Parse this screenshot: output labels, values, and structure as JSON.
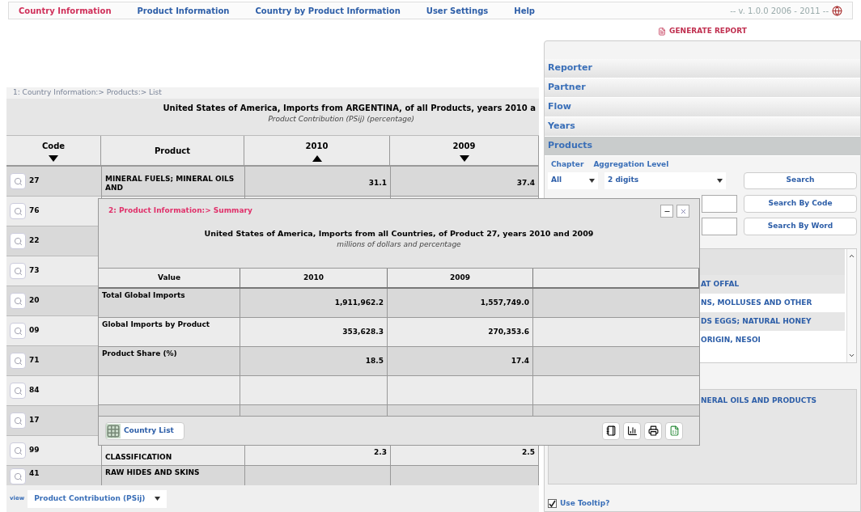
{
  "nav": {
    "tabs": [
      {
        "label": "Country Information",
        "selected": true
      },
      {
        "label": "Product Information",
        "selected": false
      },
      {
        "label": "Country by Product Information",
        "selected": false
      },
      {
        "label": "User Settings",
        "selected": false
      },
      {
        "label": "Help",
        "selected": false
      }
    ],
    "version": "-- v. 1.0.0 2006 - 2011 --"
  },
  "list_panel": {
    "breadcrumb": "1: Country Information:> Products:> List",
    "title": "United States of America, Imports from ARGENTINA, of all Products, years 2010 a",
    "subtitle": "Product Contribution (PSij) (percentage)",
    "columns": [
      {
        "label": "Code",
        "arrow": true,
        "ascending": false
      },
      {
        "label": "Product",
        "arrow": false
      },
      {
        "label": "2010",
        "arrow": true,
        "ascending": true
      },
      {
        "label": "2009",
        "arrow": true,
        "ascending": false
      }
    ],
    "rows": [
      {
        "code": "27",
        "product": "MINERAL FUELS; MINERAL OILS AND",
        "v2010": "31.1",
        "v2009": "37.4"
      },
      {
        "code": "76"
      },
      {
        "code": "22"
      },
      {
        "code": "73"
      },
      {
        "code": "20"
      },
      {
        "code": "09"
      },
      {
        "code": "71"
      },
      {
        "code": "84"
      },
      {
        "code": "17"
      },
      {
        "code": "99",
        "product": "CLASSIFICATION",
        "v2010": "2.3",
        "v2009": "2.5"
      },
      {
        "code": "41",
        "product": "RAW HIDES AND SKINS"
      }
    ],
    "view_label": "view",
    "view_value": "Product Contribution (PSij)"
  },
  "report_panel": {
    "header": "GENERATE REPORT",
    "sections": [
      {
        "label": "Reporter",
        "expanded": false
      },
      {
        "label": "Partner",
        "expanded": false
      },
      {
        "label": "Flow",
        "expanded": false
      },
      {
        "label": "Years",
        "expanded": false
      },
      {
        "label": "Products",
        "expanded": true
      }
    ],
    "chapter_label": "Chapter",
    "chapter_value": "All",
    "aggregation_label": "Aggregation Level",
    "aggregation_value": "2 digits",
    "buttons": [
      "Search",
      "Search By Code",
      "Search By Word"
    ],
    "results": [
      "AT OFFAL",
      "NS, MOLLUSES AND OTHER",
      "DS EGGS; NATURAL HONEY",
      "ORIGIN, NESOI"
    ],
    "selected_items": [
      "NERAL OILS AND PRODUCTS"
    ],
    "tooltip": {
      "label": "Use Tooltip?",
      "checked": true
    }
  },
  "popup": {
    "title": "2: Product Information:> Summary",
    "heading": "United States of America, Imports from all Countries, of Product 27, years 2010 and 2009",
    "subtitle": "millions of dollars and percentage",
    "columns": [
      "Value",
      "2010",
      "2009"
    ],
    "rows": [
      {
        "label": "Total Global Imports",
        "v2010": "1,911,962.2",
        "v2009": "1,557,749.0"
      },
      {
        "label": "Global Imports by Product",
        "v2010": "353,628.3",
        "v2009": "270,353.6"
      },
      {
        "label": "Product Share (%)",
        "v2010": "18.5",
        "v2009": "17.4"
      }
    ],
    "country_list": "Country List"
  }
}
